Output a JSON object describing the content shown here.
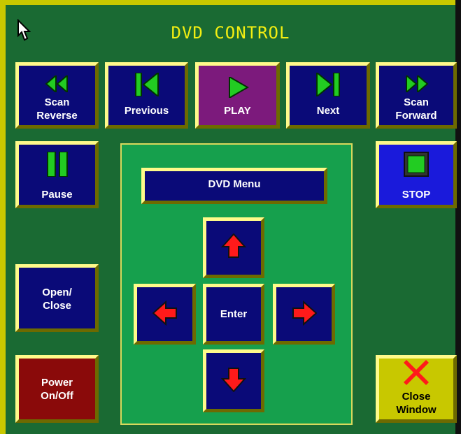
{
  "title": "DVD CONTROL",
  "buttons": {
    "scan_reverse": "Scan\nReverse",
    "previous": "Previous",
    "play": "PLAY",
    "next": "Next",
    "scan_forward": "Scan\nForward",
    "pause": "Pause",
    "dvd_menu": "DVD Menu",
    "stop": "STOP",
    "open_close": "Open/\nClose",
    "enter": "Enter",
    "power": "Power\nOn/Off",
    "close_window": "Close\nWindow"
  },
  "colors": {
    "background": "#1a6a33",
    "title": "#f2ee12",
    "button_blue": "#0a0a78",
    "play_purple": "#7c1a7c",
    "stop_blue": "#1a1adb",
    "power_red": "#8a0a0a",
    "close_yellow": "#c8c800",
    "accent_green": "#22cc22",
    "arrow_red": "#ff1a1a"
  },
  "icons": {
    "scan_reverse": "double-left-triangle-icon",
    "previous": "skip-previous-icon",
    "play": "play-triangle-icon",
    "next": "skip-next-icon",
    "scan_forward": "double-right-triangle-icon",
    "pause": "pause-bars-icon",
    "stop": "stop-square-icon",
    "up": "up-arrow-icon",
    "left": "left-arrow-icon",
    "right": "right-arrow-icon",
    "down": "down-arrow-icon",
    "close": "red-x-icon",
    "cursor": "mouse-pointer-icon"
  }
}
